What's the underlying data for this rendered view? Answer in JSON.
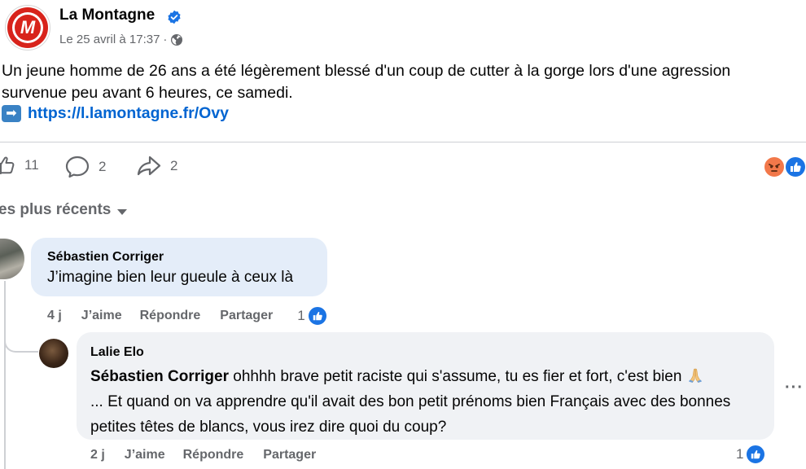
{
  "post": {
    "page_name": "La Montagne",
    "avatar_letter": "M",
    "timestamp": "Le 25 avril à 17:37",
    "separator": "·",
    "text": "Un jeune homme de 26 ans a été légèrement blessé d'un coup de cutter à la gorge lors d'une agression survenue peu avant 6 heures, ce samedi.",
    "link_arrow": "➡",
    "link": "https://l.lamontagne.fr/Ovy"
  },
  "actions": {
    "like_count": "11",
    "comment_count": "2",
    "share_count": "2"
  },
  "sort": {
    "label": "es plus récents"
  },
  "comments": [
    {
      "author": "Sébastien Corriger",
      "text": "J’imagine bien leur gueule à ceux là",
      "age": "4 j",
      "like_label": "J’aime",
      "reply_label": "Répondre",
      "share_label": "Partager",
      "likes": "1"
    },
    {
      "author": "Lalie Elo",
      "mention": "Sébastien Corriger",
      "text_line1": " ohhhh brave petit raciste qui s'assume, tu es fier et fort, c'est bien ",
      "text_rest": "... Et quand on va apprendre qu'il avait des bon petit prénoms bien Français avec des bonnes petites têtes de blancs, vous irez dire quoi du coup?",
      "age": "2 j",
      "like_label": "J’aime",
      "reply_label": "Répondre",
      "share_label": "Partager",
      "likes": "1",
      "more": "···"
    }
  ],
  "colors": {
    "brand_red": "#d8231b",
    "link_blue": "#0064d1",
    "facebook_blue": "#1b74e4",
    "muted_text": "#65676b"
  }
}
